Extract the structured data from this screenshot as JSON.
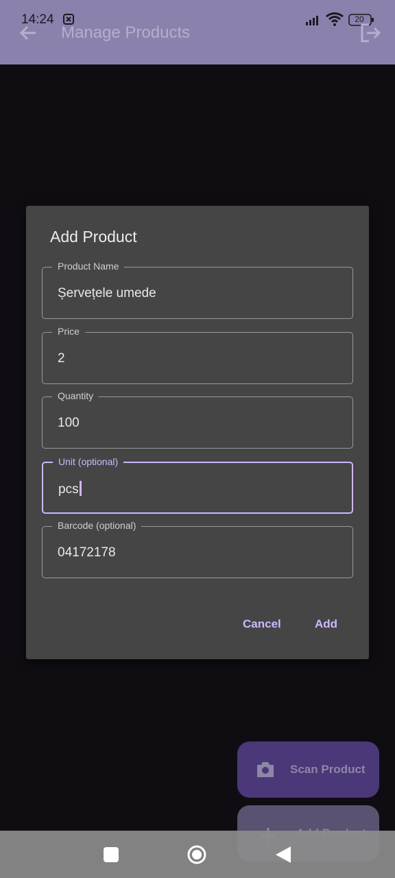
{
  "status_bar": {
    "time": "14:24",
    "battery": "20"
  },
  "app_bar": {
    "title": "Manage Products",
    "back_icon": "arrow-back-icon",
    "logout_icon": "logout-icon"
  },
  "dialog": {
    "title": "Add Product",
    "fields": [
      {
        "label": "Product Name",
        "value": "Șervețele umede"
      },
      {
        "label": "Price",
        "value": "2"
      },
      {
        "label": "Quantity",
        "value": "100"
      },
      {
        "label": "Unit (optional)",
        "value": "pcs"
      },
      {
        "label": "Barcode (optional)",
        "value": "04172178"
      }
    ],
    "cancel_label": "Cancel",
    "add_label": "Add"
  },
  "fabs": {
    "scan_label": "Scan Product",
    "scan_icon": "camera-icon",
    "add_label": "Add Product",
    "add_icon": "plus-icon"
  },
  "colors": {
    "accent": "#cdb8ff",
    "dialog_bg": "#454545",
    "app_bar": "#8c80ad"
  }
}
